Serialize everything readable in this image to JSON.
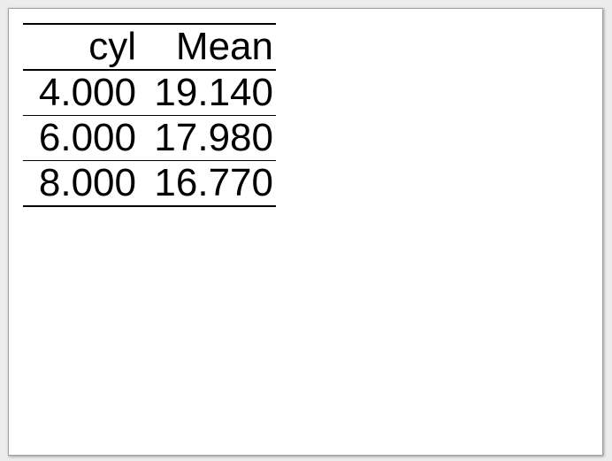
{
  "table": {
    "headers": [
      "cyl",
      "Mean"
    ],
    "rows": [
      [
        "4.000",
        "19.140"
      ],
      [
        "6.000",
        "17.980"
      ],
      [
        "8.000",
        "16.770"
      ]
    ]
  }
}
